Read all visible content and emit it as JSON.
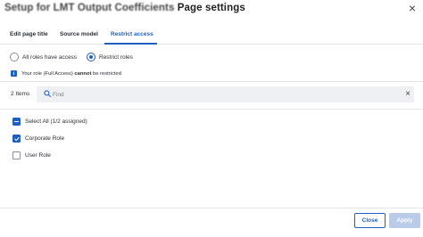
{
  "dialog": {
    "title_obscured": "Setup for LMT Output Coefficients",
    "title_suffix": " Page settings",
    "close_glyph": "×"
  },
  "tabs": [
    {
      "label": "Edit page title",
      "active": false
    },
    {
      "label": "Source model",
      "active": false
    },
    {
      "label": "Restrict access",
      "active": true
    }
  ],
  "access": {
    "options": [
      {
        "label": "All roles have access",
        "checked": false
      },
      {
        "label": "Restrict roles",
        "checked": true
      }
    ],
    "info_icon": "i",
    "info_prefix": "Your role (Full Access) ",
    "info_bold": "cannot",
    "info_suffix": " be restricted"
  },
  "list": {
    "count": "2 Items",
    "search_placeholder": "Find",
    "search_value": "",
    "clear_glyph": "×",
    "select_all": {
      "label": "Select All (1/2 assigned)",
      "state": "partial"
    },
    "roles": [
      {
        "label": "Corporate Role",
        "checked": true
      },
      {
        "label": "User Role",
        "checked": false
      }
    ]
  },
  "footer": {
    "close_label": "Close",
    "apply_label": "Apply",
    "apply_enabled": false
  },
  "colors": {
    "accent": "#1e5fbf",
    "apply_disabled_bg": "#b9cbe8",
    "divider": "#e3e5e8",
    "search_bg": "#eef0f3"
  },
  "icons": {
    "info": "info-icon",
    "search": "search-icon",
    "close": "close-icon",
    "clear": "clear-icon",
    "check": "check-icon",
    "minus": "minus-icon"
  }
}
